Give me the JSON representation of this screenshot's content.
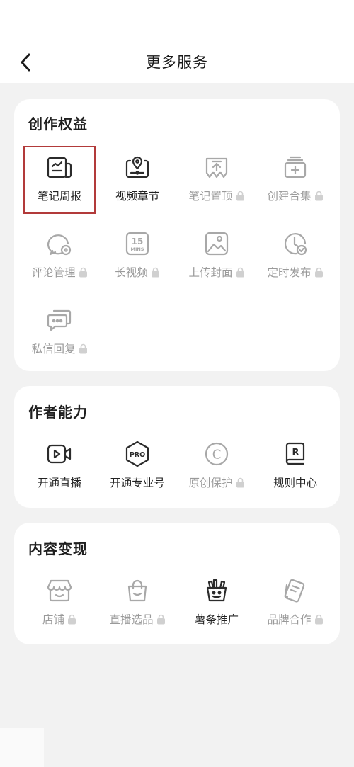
{
  "header": {
    "back_icon": "chevron-left-icon",
    "title": "更多服务"
  },
  "sections": [
    {
      "title": "创作权益",
      "items": [
        {
          "label": "笔记周报",
          "icon": "weekly-report-icon",
          "locked": false,
          "highlighted": true
        },
        {
          "label": "视频章节",
          "icon": "video-chapter-icon",
          "locked": false
        },
        {
          "label": "笔记置顶",
          "icon": "pin-top-icon",
          "locked": true
        },
        {
          "label": "创建合集",
          "icon": "collection-add-icon",
          "locked": true
        },
        {
          "label": "评论管理",
          "icon": "comment-manage-icon",
          "locked": true
        },
        {
          "label": "长视频",
          "icon": "long-video-icon",
          "locked": true
        },
        {
          "label": "上传封面",
          "icon": "upload-cover-icon",
          "locked": true
        },
        {
          "label": "定时发布",
          "icon": "scheduled-publish-icon",
          "locked": true
        },
        {
          "label": "私信回复",
          "icon": "message-reply-icon",
          "locked": true
        }
      ]
    },
    {
      "title": "作者能力",
      "items": [
        {
          "label": "开通直播",
          "icon": "live-stream-icon",
          "locked": false
        },
        {
          "label": "开通专业号",
          "icon": "pro-account-icon",
          "locked": false
        },
        {
          "label": "原创保护",
          "icon": "copyright-icon",
          "locked": true
        },
        {
          "label": "规则中心",
          "icon": "rules-center-icon",
          "locked": false
        }
      ]
    },
    {
      "title": "内容变现",
      "items": [
        {
          "label": "店铺",
          "icon": "store-icon",
          "locked": true
        },
        {
          "label": "直播选品",
          "icon": "shopping-bag-icon",
          "locked": true
        },
        {
          "label": "薯条推广",
          "icon": "fries-promote-icon",
          "locked": false
        },
        {
          "label": "品牌合作",
          "icon": "brand-cooperation-icon",
          "locked": true
        }
      ]
    }
  ],
  "icon_text": {
    "mins_num": "15",
    "mins_unit": "MINS",
    "pro": "PRO",
    "rules": "R",
    "copyright": "C"
  },
  "colors": {
    "background": "#f2f2f2",
    "card": "#ffffff",
    "active_icon": "#2b2b2b",
    "locked_icon": "#a8a8a8",
    "highlight_border": "#b23a3a"
  }
}
